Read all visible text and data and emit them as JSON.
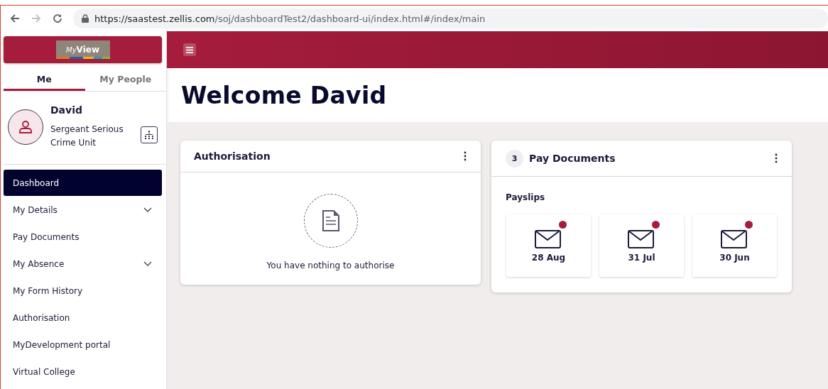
{
  "browser": {
    "url_host": "https://saastest.zellis.com",
    "url_path": "/soj/dashboardTest2/dashboard-ui/index.html#/index/main"
  },
  "logo": {
    "prefix": "My",
    "name": "View"
  },
  "tabs": [
    {
      "label": "Me",
      "selected": true
    },
    {
      "label": "My People",
      "selected": false
    }
  ],
  "profile": {
    "name": "David",
    "role": "Sergeant Serious Crime Unit"
  },
  "nav": [
    {
      "label": "Dashboard",
      "selected": true,
      "has_submenu": false
    },
    {
      "label": "My Details",
      "selected": false,
      "has_submenu": true
    },
    {
      "label": "Pay Documents",
      "selected": false,
      "has_submenu": false
    },
    {
      "label": "My Absence",
      "selected": false,
      "has_submenu": true
    },
    {
      "label": "My Form History",
      "selected": false,
      "has_submenu": false
    },
    {
      "label": "Authorisation",
      "selected": false,
      "has_submenu": false
    },
    {
      "label": "MyDevelopment portal",
      "selected": false,
      "has_submenu": false
    },
    {
      "label": "Virtual College",
      "selected": false,
      "has_submenu": false
    }
  ],
  "welcome": "Welcome David",
  "authorisation": {
    "title": "Authorisation",
    "empty_message": "You have nothing to authorise"
  },
  "pay_documents": {
    "count": "3",
    "title": "Pay Documents",
    "section": "Payslips",
    "payslips": [
      {
        "date": "28 Aug",
        "unread": true
      },
      {
        "date": "31 Jul",
        "unread": true
      },
      {
        "date": "30 Jun",
        "unread": true
      }
    ]
  }
}
